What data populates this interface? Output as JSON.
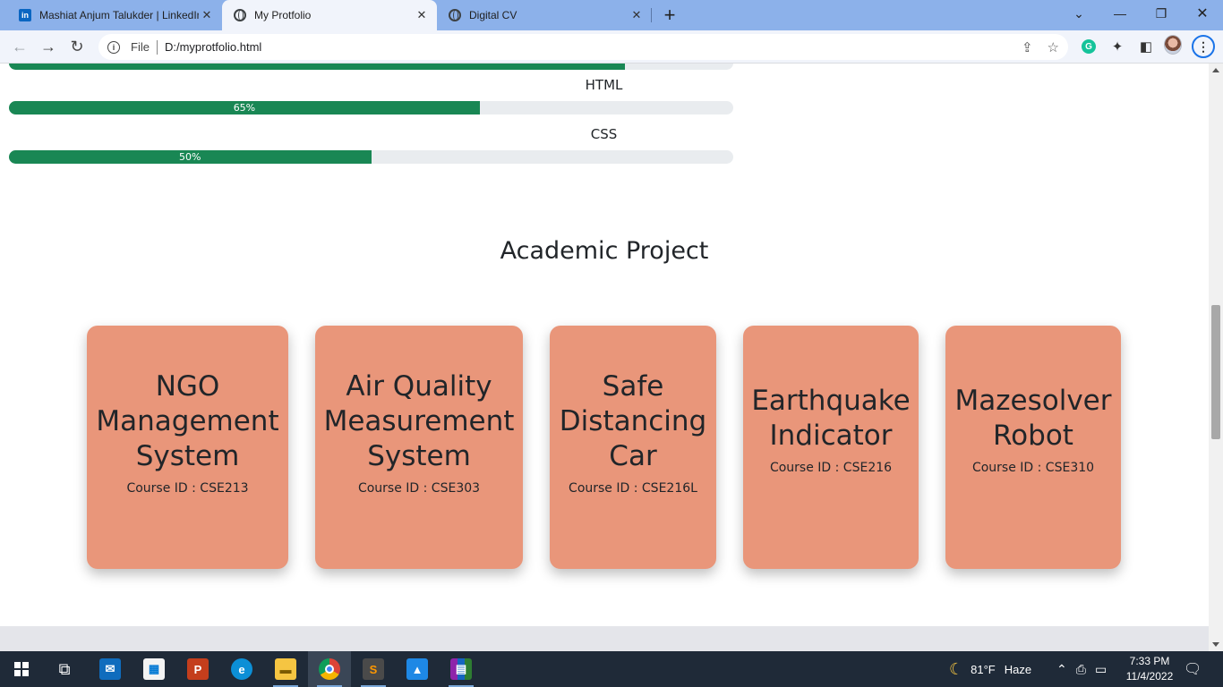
{
  "browser": {
    "tabs": [
      {
        "title": "Mashiat Anjum Talukder | LinkedIn",
        "icon": "linkedin-icon",
        "active": false
      },
      {
        "title": "My Protfolio",
        "icon": "globe-icon",
        "active": true
      },
      {
        "title": "Digital CV",
        "icon": "globe-icon",
        "active": false
      }
    ],
    "address": {
      "scheme_label": "File",
      "url": "D:/myprotfolio.html"
    }
  },
  "skills": [
    {
      "label": "HTML",
      "percent": 65,
      "percent_text": "65%"
    },
    {
      "label": "CSS",
      "percent": 50,
      "percent_text": "50%"
    }
  ],
  "previous_skill_percent": 85,
  "section": {
    "title": "Academic Project"
  },
  "projects": [
    {
      "name": "NGO Management System",
      "course": "Course ID : CSE213"
    },
    {
      "name": "Air Quality Measurement System",
      "course": "Course ID : CSE303"
    },
    {
      "name": "Safe Distancing Car",
      "course": "Course ID : CSE216L"
    },
    {
      "name": "Earthquake Indicator",
      "course": "Course ID : CSE216"
    },
    {
      "name": "Mazesolver Robot",
      "course": "Course ID : CSE310"
    }
  ],
  "colors": {
    "card_bg": "#e9967a",
    "progress_fill": "#198754",
    "progress_track": "#e9ecef"
  },
  "taskbar": {
    "weather_temp": "81°F",
    "weather_cond": "Haze",
    "time": "7:33 PM",
    "date": "11/4/2022"
  }
}
